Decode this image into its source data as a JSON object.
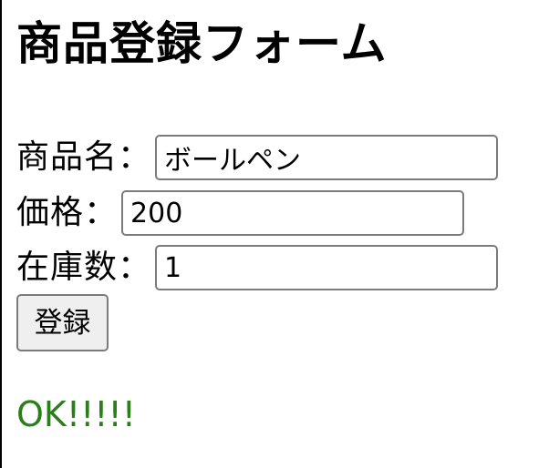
{
  "form": {
    "title": "商品登録フォーム",
    "fields": [
      {
        "label": "商品名：",
        "value": "ボールペン"
      },
      {
        "label": "価格：",
        "value": "200"
      },
      {
        "label": "在庫数：",
        "value": "1"
      }
    ],
    "submit_label": "登録"
  },
  "status": {
    "message": "OK!!!!!",
    "color": "#2b7f1a"
  }
}
